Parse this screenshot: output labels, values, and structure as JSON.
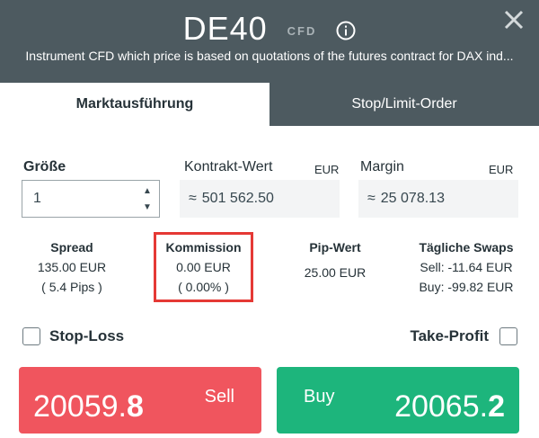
{
  "header": {
    "symbol": "DE40",
    "instrument_type": "CFD",
    "description": "Instrument CFD which price is based on quotations of the futures contract for DAX ind..."
  },
  "tabs": [
    {
      "label": "Marktausführung",
      "active": true
    },
    {
      "label": "Stop/Limit-Order",
      "active": false
    }
  ],
  "size": {
    "label": "Größe",
    "value": "1"
  },
  "contract_value": {
    "label": "Kontrakt-Wert",
    "currency": "EUR",
    "approx": "≈",
    "value": "501 562.50"
  },
  "margin": {
    "label": "Margin",
    "currency": "EUR",
    "approx": "≈",
    "value": "25 078.13"
  },
  "stats": {
    "spread": {
      "title": "Spread",
      "line1": "135.00 EUR",
      "line2": "( 5.4 Pips )"
    },
    "commission": {
      "title": "Kommission",
      "line1": "0.00 EUR",
      "line2": "( 0.00% )"
    },
    "pip_value": {
      "title": "Pip-Wert",
      "line1": "25.00 EUR"
    },
    "swaps": {
      "title": "Tägliche Swaps",
      "line1": "Sell: -11.64 EUR",
      "line2": "Buy: -99.82 EUR"
    }
  },
  "stop_loss": {
    "label": "Stop-Loss",
    "checked": false
  },
  "take_profit": {
    "label": "Take-Profit",
    "checked": false
  },
  "sell": {
    "label": "Sell",
    "price_main": "20059.",
    "price_last": "8"
  },
  "buy": {
    "label": "Buy",
    "price_main": "20065.",
    "price_last": "2"
  },
  "colors": {
    "header": "#4d5a60",
    "sell": "#f0555e",
    "buy": "#1db57c",
    "highlight": "#e53935"
  }
}
